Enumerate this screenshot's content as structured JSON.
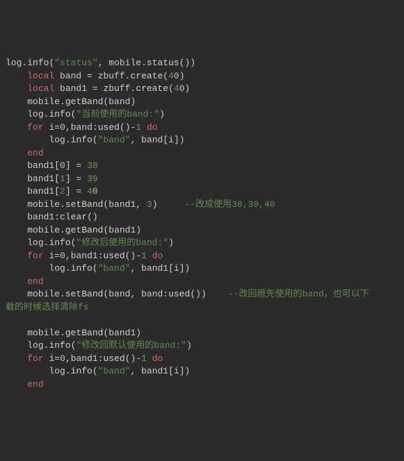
{
  "code": {
    "lines": [
      {
        "indent": 0,
        "segs": [
          [
            "ident",
            "log"
          ],
          [
            "punc",
            "."
          ],
          [
            "method",
            "info"
          ],
          [
            "punc",
            "("
          ],
          [
            "str",
            "\"status\""
          ],
          [
            "punc",
            ", "
          ],
          [
            "ident",
            "mobile"
          ],
          [
            "punc",
            "."
          ],
          [
            "method",
            "status"
          ],
          [
            "punc",
            "())"
          ]
        ]
      },
      {
        "indent": 1,
        "segs": [
          [
            "kw",
            "local "
          ],
          [
            "ident",
            "band "
          ],
          [
            "punc",
            "= "
          ],
          [
            "ident",
            "zbuff"
          ],
          [
            "punc",
            "."
          ],
          [
            "method",
            "create"
          ],
          [
            "punc",
            "("
          ],
          [
            "num",
            "4"
          ],
          [
            "num-in",
            "0"
          ],
          [
            "punc",
            ")"
          ]
        ]
      },
      {
        "indent": 1,
        "segs": [
          [
            "kw",
            "local "
          ],
          [
            "ident",
            "band1 "
          ],
          [
            "punc",
            "= "
          ],
          [
            "ident",
            "zbuff"
          ],
          [
            "punc",
            "."
          ],
          [
            "method",
            "create"
          ],
          [
            "punc",
            "("
          ],
          [
            "num",
            "4"
          ],
          [
            "num-in",
            "0"
          ],
          [
            "punc",
            ")"
          ]
        ]
      },
      {
        "indent": 1,
        "segs": [
          [
            "ident",
            "mobile"
          ],
          [
            "punc",
            "."
          ],
          [
            "method",
            "getBand"
          ],
          [
            "punc",
            "("
          ],
          [
            "ident",
            "band"
          ],
          [
            "punc",
            ")"
          ]
        ]
      },
      {
        "indent": 1,
        "segs": [
          [
            "ident",
            "log"
          ],
          [
            "punc",
            "."
          ],
          [
            "method",
            "info"
          ],
          [
            "punc",
            "("
          ],
          [
            "str",
            "\"当前使用的band:\""
          ],
          [
            "punc",
            ")"
          ]
        ]
      },
      {
        "indent": 1,
        "segs": [
          [
            "kw",
            "for "
          ],
          [
            "ident",
            "i"
          ],
          [
            "punc",
            "="
          ],
          [
            "num-in",
            "0"
          ],
          [
            "punc",
            ","
          ],
          [
            "ident",
            "band"
          ],
          [
            "punc",
            ":"
          ],
          [
            "method",
            "used"
          ],
          [
            "punc",
            "()-"
          ],
          [
            "num",
            "1 "
          ],
          [
            "kw",
            "do"
          ]
        ]
      },
      {
        "indent": 2,
        "segs": [
          [
            "ident",
            "log"
          ],
          [
            "punc",
            "."
          ],
          [
            "method",
            "info"
          ],
          [
            "punc",
            "("
          ],
          [
            "str",
            "\"band\""
          ],
          [
            "punc",
            ", "
          ],
          [
            "ident",
            "band"
          ],
          [
            "punc",
            "["
          ],
          [
            "ident",
            "i"
          ],
          [
            "punc",
            "])"
          ]
        ]
      },
      {
        "indent": 1,
        "segs": [
          [
            "kw",
            "end"
          ]
        ]
      },
      {
        "indent": 1,
        "segs": [
          [
            "ident",
            "band1"
          ],
          [
            "punc",
            "["
          ],
          [
            "num-in",
            "0"
          ],
          [
            "punc",
            "] = "
          ],
          [
            "num",
            "38"
          ]
        ]
      },
      {
        "indent": 1,
        "segs": [
          [
            "ident",
            "band1"
          ],
          [
            "punc",
            "["
          ],
          [
            "num",
            "1"
          ],
          [
            "punc",
            "] = "
          ],
          [
            "num",
            "39"
          ]
        ]
      },
      {
        "indent": 1,
        "segs": [
          [
            "ident",
            "band1"
          ],
          [
            "punc",
            "["
          ],
          [
            "num",
            "2"
          ],
          [
            "punc",
            "] = "
          ],
          [
            "num",
            "4"
          ],
          [
            "num-in",
            "0"
          ]
        ]
      },
      {
        "indent": 1,
        "segs": [
          [
            "ident",
            "mobile"
          ],
          [
            "punc",
            "."
          ],
          [
            "method",
            "setBand"
          ],
          [
            "punc",
            "("
          ],
          [
            "ident",
            "band1"
          ],
          [
            "punc",
            ", "
          ],
          [
            "num",
            "3"
          ],
          [
            "punc",
            ")     "
          ],
          [
            "comment",
            "--改成使用38,39,40"
          ]
        ]
      },
      {
        "indent": 1,
        "segs": [
          [
            "ident",
            "band1"
          ],
          [
            "punc",
            ":"
          ],
          [
            "method",
            "clear"
          ],
          [
            "punc",
            "()"
          ]
        ]
      },
      {
        "indent": 1,
        "segs": [
          [
            "ident",
            "mobile"
          ],
          [
            "punc",
            "."
          ],
          [
            "method",
            "getBand"
          ],
          [
            "punc",
            "("
          ],
          [
            "ident",
            "band1"
          ],
          [
            "punc",
            ")"
          ]
        ]
      },
      {
        "indent": 1,
        "segs": [
          [
            "ident",
            "log"
          ],
          [
            "punc",
            "."
          ],
          [
            "method",
            "info"
          ],
          [
            "punc",
            "("
          ],
          [
            "str",
            "\"修改后使用的band:\""
          ],
          [
            "punc",
            ")"
          ]
        ]
      },
      {
        "indent": 1,
        "segs": [
          [
            "kw",
            "for "
          ],
          [
            "ident",
            "i"
          ],
          [
            "punc",
            "="
          ],
          [
            "num-in",
            "0"
          ],
          [
            "punc",
            ","
          ],
          [
            "ident",
            "band1"
          ],
          [
            "punc",
            ":"
          ],
          [
            "method",
            "used"
          ],
          [
            "punc",
            "()-"
          ],
          [
            "num",
            "1 "
          ],
          [
            "kw",
            "do"
          ]
        ]
      },
      {
        "indent": 2,
        "segs": [
          [
            "ident",
            "log"
          ],
          [
            "punc",
            "."
          ],
          [
            "method",
            "info"
          ],
          [
            "punc",
            "("
          ],
          [
            "str",
            "\"band\""
          ],
          [
            "punc",
            ", "
          ],
          [
            "ident",
            "band1"
          ],
          [
            "punc",
            "["
          ],
          [
            "ident",
            "i"
          ],
          [
            "punc",
            "])"
          ]
        ]
      },
      {
        "indent": 1,
        "segs": [
          [
            "kw",
            "end"
          ]
        ]
      },
      {
        "indent": 1,
        "segs": [
          [
            "ident",
            "mobile"
          ],
          [
            "punc",
            "."
          ],
          [
            "method",
            "setBand"
          ],
          [
            "punc",
            "("
          ],
          [
            "ident",
            "band"
          ],
          [
            "punc",
            ", "
          ],
          [
            "ident",
            "band"
          ],
          [
            "punc",
            ":"
          ],
          [
            "method",
            "used"
          ],
          [
            "punc",
            "())    "
          ],
          [
            "comment",
            "--改回原先使用的band，也可以下"
          ]
        ]
      },
      {
        "indent": -1,
        "segs": [
          [
            "comment",
            "载的时候选择清除fs"
          ]
        ]
      },
      {
        "indent": -2,
        "segs": []
      },
      {
        "indent": 1,
        "segs": [
          [
            "ident",
            "mobile"
          ],
          [
            "punc",
            "."
          ],
          [
            "method",
            "getBand"
          ],
          [
            "punc",
            "("
          ],
          [
            "ident",
            "band1"
          ],
          [
            "punc",
            ")"
          ]
        ]
      },
      {
        "indent": 1,
        "segs": [
          [
            "ident",
            "log"
          ],
          [
            "punc",
            "."
          ],
          [
            "method",
            "info"
          ],
          [
            "punc",
            "("
          ],
          [
            "str",
            "\"修改回默认使用的band:\""
          ],
          [
            "punc",
            ")"
          ]
        ]
      },
      {
        "indent": 1,
        "segs": [
          [
            "kw",
            "for "
          ],
          [
            "ident",
            "i"
          ],
          [
            "punc",
            "="
          ],
          [
            "num-in",
            "0"
          ],
          [
            "punc",
            ","
          ],
          [
            "ident",
            "band1"
          ],
          [
            "punc",
            ":"
          ],
          [
            "method",
            "used"
          ],
          [
            "punc",
            "()-"
          ],
          [
            "num",
            "1 "
          ],
          [
            "kw",
            "do"
          ]
        ]
      },
      {
        "indent": 2,
        "segs": [
          [
            "ident",
            "log"
          ],
          [
            "punc",
            "."
          ],
          [
            "method",
            "info"
          ],
          [
            "punc",
            "("
          ],
          [
            "str",
            "\"band\""
          ],
          [
            "punc",
            ", "
          ],
          [
            "ident",
            "band1"
          ],
          [
            "punc",
            "["
          ],
          [
            "ident",
            "i"
          ],
          [
            "punc",
            "])"
          ]
        ]
      },
      {
        "indent": 1,
        "segs": [
          [
            "kw",
            "end"
          ]
        ]
      }
    ],
    "indentUnit": "    "
  }
}
